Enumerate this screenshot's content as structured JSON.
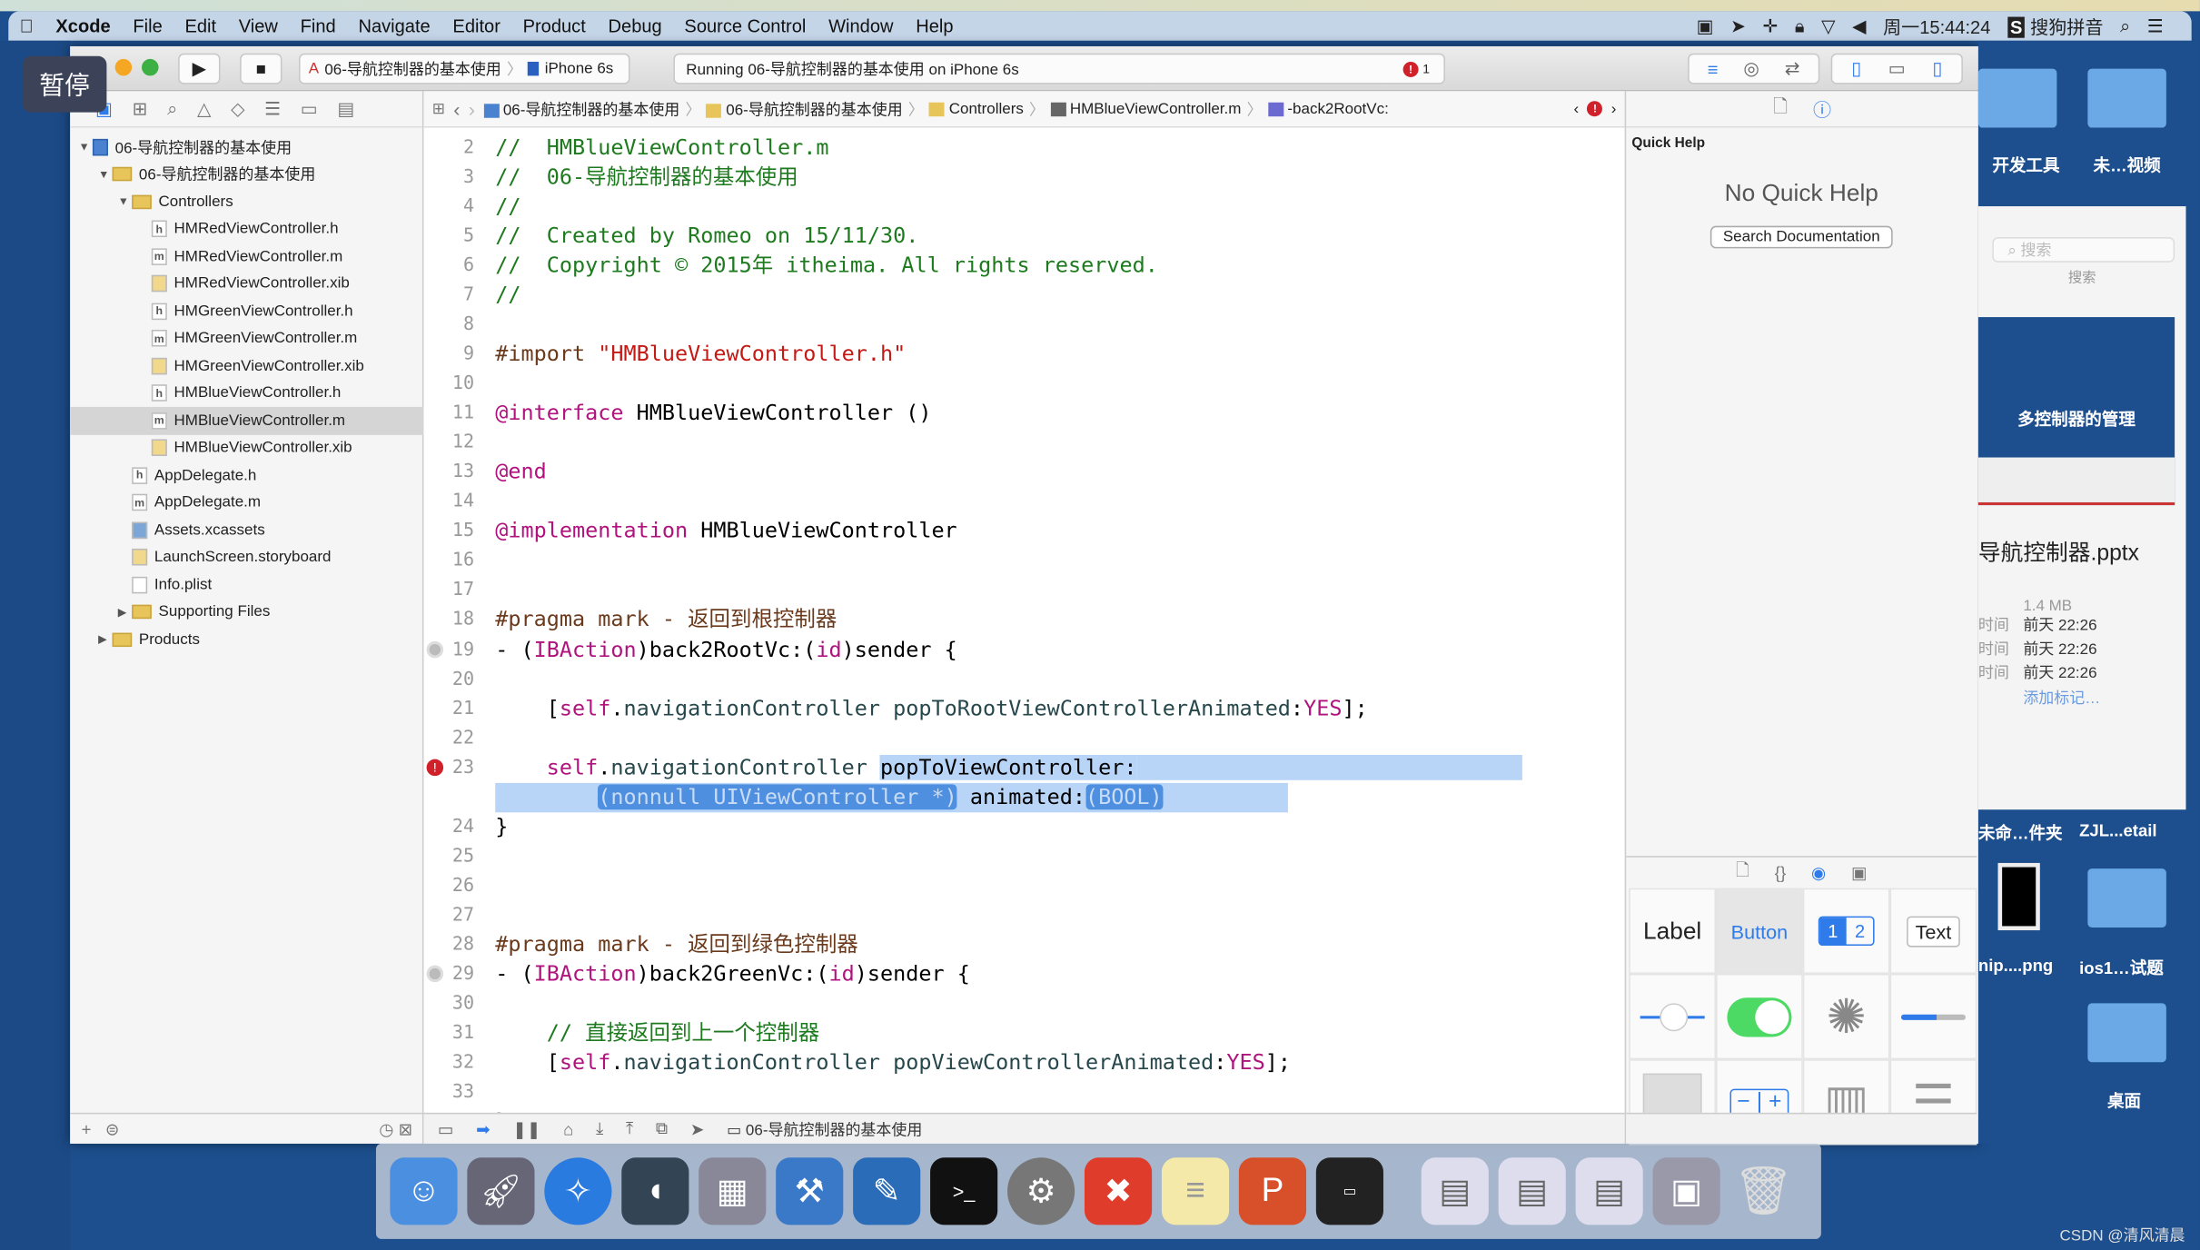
{
  "overlay": {
    "pause_label": "暂停"
  },
  "menubar": {
    "items": [
      "Xcode",
      "File",
      "Edit",
      "View",
      "Find",
      "Navigate",
      "Editor",
      "Product",
      "Debug",
      "Source Control",
      "Window",
      "Help"
    ],
    "clock": "周一15:44:24",
    "input_method": "搜狗拼音"
  },
  "toolbar": {
    "scheme": "06-导航控制器的基本使用",
    "device": "iPhone 6s",
    "status": "Running 06-导航控制器的基本使用 on iPhone 6s",
    "error_count": "1"
  },
  "jumpbar": [
    "06-导航控制器的基本使用",
    "06-导航控制器的基本使用",
    "Controllers",
    "HMBlueViewController.m",
    "-back2RootVc:"
  ],
  "navigator": {
    "items": [
      {
        "label": "06-导航控制器的基本使用",
        "level": 0,
        "icon": "proj",
        "open": true
      },
      {
        "label": "06-导航控制器的基本使用",
        "level": 1,
        "icon": "folder",
        "open": true
      },
      {
        "label": "Controllers",
        "level": 2,
        "icon": "folder",
        "open": true
      },
      {
        "label": "HMRedViewController.h",
        "level": 3,
        "icon": "h"
      },
      {
        "label": "HMRedViewController.m",
        "level": 3,
        "icon": "m"
      },
      {
        "label": "HMRedViewController.xib",
        "level": 3,
        "icon": "xib"
      },
      {
        "label": "HMGreenViewController.h",
        "level": 3,
        "icon": "h"
      },
      {
        "label": "HMGreenViewController.m",
        "level": 3,
        "icon": "m"
      },
      {
        "label": "HMGreenViewController.xib",
        "level": 3,
        "icon": "xib"
      },
      {
        "label": "HMBlueViewController.h",
        "level": 3,
        "icon": "h"
      },
      {
        "label": "HMBlueViewController.m",
        "level": 3,
        "icon": "m",
        "selected": true
      },
      {
        "label": "HMBlueViewController.xib",
        "level": 3,
        "icon": "xib"
      },
      {
        "label": "AppDelegate.h",
        "level": 2,
        "icon": "h"
      },
      {
        "label": "AppDelegate.m",
        "level": 2,
        "icon": "m"
      },
      {
        "label": "Assets.xcassets",
        "level": 2,
        "icon": "assets"
      },
      {
        "label": "LaunchScreen.storyboard",
        "level": 2,
        "icon": "xib"
      },
      {
        "label": "Info.plist",
        "level": 2,
        "icon": "plist"
      },
      {
        "label": "Supporting Files",
        "level": 2,
        "icon": "folder",
        "open": false
      },
      {
        "label": "Products",
        "level": 1,
        "icon": "folder",
        "open": false
      }
    ]
  },
  "code": [
    {
      "n": "2",
      "t": [
        [
          "//  HMBlueViewController.m",
          "cm"
        ]
      ]
    },
    {
      "n": "3",
      "t": [
        [
          "//  06-导航控制器的基本使用",
          "cm"
        ]
      ]
    },
    {
      "n": "4",
      "t": [
        [
          "//",
          "cm"
        ]
      ]
    },
    {
      "n": "5",
      "t": [
        [
          "//  Created by Romeo on 15/11/30.",
          "cm"
        ]
      ]
    },
    {
      "n": "6",
      "t": [
        [
          "//  Copyright © 2015年 itheima. All rights reserved.",
          "cm"
        ]
      ]
    },
    {
      "n": "7",
      "t": [
        [
          "//",
          "cm"
        ]
      ]
    },
    {
      "n": "8",
      "t": []
    },
    {
      "n": "9",
      "t": [
        [
          "#import ",
          "pr"
        ],
        [
          "\"HMBlueViewController.h\"",
          "st"
        ]
      ]
    },
    {
      "n": "10",
      "t": []
    },
    {
      "n": "11",
      "t": [
        [
          "@interface",
          "kw"
        ],
        [
          " HMBlueViewController ()",
          ""
        ]
      ]
    },
    {
      "n": "12",
      "t": []
    },
    {
      "n": "13",
      "t": [
        [
          "@end",
          "kw"
        ]
      ]
    },
    {
      "n": "14",
      "t": []
    },
    {
      "n": "15",
      "t": [
        [
          "@implementation",
          "kw"
        ],
        [
          " HMBlueViewController",
          ""
        ]
      ]
    },
    {
      "n": "16",
      "t": []
    },
    {
      "n": "17",
      "t": []
    },
    {
      "n": "18",
      "t": [
        [
          "#pragma mark - 返回到根控制器",
          "pr"
        ]
      ]
    },
    {
      "n": "19",
      "mark": "breakpoint",
      "t": [
        [
          "- (",
          ""
        ],
        [
          "IBAction",
          "kw"
        ],
        [
          ")back2RootVc:(",
          ""
        ],
        [
          "id",
          "kw"
        ],
        [
          ")sender {",
          ""
        ]
      ]
    },
    {
      "n": "20",
      "t": []
    },
    {
      "n": "21",
      "t": [
        [
          "    [",
          ""
        ],
        [
          "self",
          "kw"
        ],
        [
          ".",
          ""
        ],
        [
          "navigationController",
          "mt"
        ],
        [
          " ",
          ""
        ],
        [
          "popToRootViewControllerAnimated",
          "mt"
        ],
        [
          ":",
          ""
        ],
        [
          "YES",
          "kw"
        ],
        [
          "];",
          ""
        ]
      ]
    },
    {
      "n": "22",
      "t": []
    },
    {
      "n": "23",
      "mark": "error",
      "t": [
        [
          "    ",
          ""
        ],
        [
          "self",
          "kw"
        ],
        [
          ".",
          ""
        ],
        [
          "navigationController",
          "mt"
        ],
        [
          " ",
          ""
        ],
        [
          "popToViewController:",
          "hl"
        ]
      ]
    },
    {
      "n": "",
      "wrap": true,
      "t": [
        [
          "        ",
          ""
        ],
        [
          "(nonnull UIViewController *)",
          "ph"
        ],
        [
          " animated:",
          ""
        ],
        [
          "(BOOL)",
          "ph"
        ]
      ]
    },
    {
      "n": "24",
      "t": [
        [
          "}",
          ""
        ]
      ]
    },
    {
      "n": "25",
      "t": []
    },
    {
      "n": "26",
      "t": []
    },
    {
      "n": "27",
      "t": []
    },
    {
      "n": "28",
      "t": [
        [
          "#pragma mark - 返回到绿色控制器",
          "pr"
        ]
      ]
    },
    {
      "n": "29",
      "mark": "breakpoint",
      "t": [
        [
          "- (",
          ""
        ],
        [
          "IBAction",
          "kw"
        ],
        [
          ")back2GreenVc:(",
          ""
        ],
        [
          "id",
          "kw"
        ],
        [
          ")sender {",
          ""
        ]
      ]
    },
    {
      "n": "30",
      "t": []
    },
    {
      "n": "31",
      "t": [
        [
          "    // 直接返回到上一个控制器",
          "cm"
        ]
      ]
    },
    {
      "n": "32",
      "t": [
        [
          "    [",
          ""
        ],
        [
          "self",
          "kw"
        ],
        [
          ".",
          ""
        ],
        [
          "navigationController",
          "mt"
        ],
        [
          " ",
          ""
        ],
        [
          "popViewControllerAnimated",
          "mt"
        ],
        [
          ":",
          ""
        ],
        [
          "YES",
          "kw"
        ],
        [
          "];",
          ""
        ]
      ]
    },
    {
      "n": "33",
      "t": []
    },
    {
      "n": "34",
      "t": [
        [
          "}",
          ""
        ]
      ]
    }
  ],
  "editor_bottom": {
    "target": "06-导航控制器的基本使用"
  },
  "inspector": {
    "title": "Quick Help",
    "empty": "No Quick Help",
    "search_button": "Search Documentation"
  },
  "library": {
    "label": "Label",
    "button": "Button",
    "seg1": "1",
    "seg2": "2",
    "text": "Text"
  },
  "desktop": {
    "labels": [
      "开发工具",
      "未…视频",
      "未命…件夹",
      "ZJL...etail",
      "nip....png",
      "ios1…试题",
      "桌面"
    ],
    "quicklook": {
      "search_placeholder": "搜索",
      "search_label": "搜索",
      "slide_title": "多控制器的管理",
      "filename": "导航控制器.pptx",
      "size": "1.4 MB",
      "rows": [
        [
          "时间",
          "前天 22:26"
        ],
        [
          "时间",
          "前天 22:26"
        ],
        [
          "时间",
          "前天 22:26"
        ]
      ],
      "add_tag": "添加标记…"
    }
  },
  "watermark": "CSDN @清风清晨",
  "colors": {
    "accent": "#2f7bea",
    "error": "#d0202a",
    "selection": "#b8d5f7"
  }
}
